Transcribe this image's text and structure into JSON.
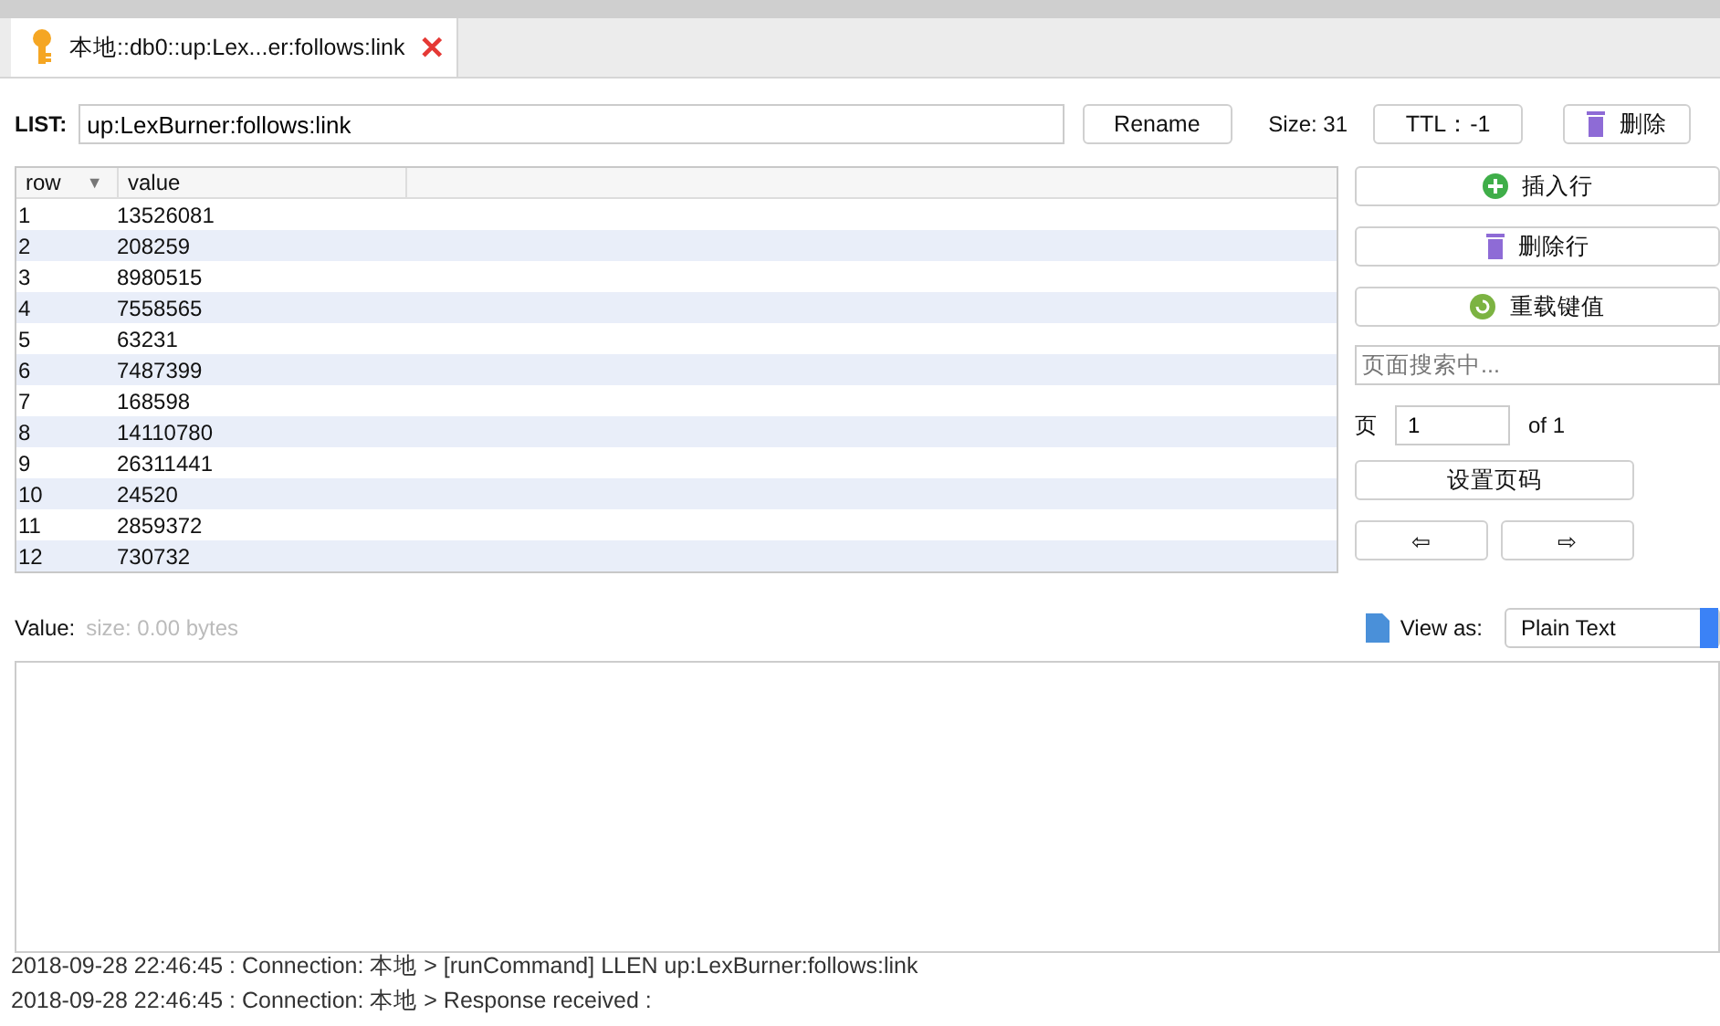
{
  "tab": {
    "title": "本地::db0::up:Lex...er:follows:link",
    "close": "✕"
  },
  "toolbar": {
    "type_label": "LIST:",
    "key_name": "up:LexBurner:follows:link",
    "rename": "Rename",
    "size": "Size: 31",
    "ttl": "TTL：-1",
    "delete": "删除"
  },
  "table": {
    "columns": [
      "row",
      "value"
    ],
    "sort_mark": "▼",
    "rows": [
      [
        "1",
        "13526081"
      ],
      [
        "2",
        "208259"
      ],
      [
        "3",
        "8980515"
      ],
      [
        "4",
        "7558565"
      ],
      [
        "5",
        "63231"
      ],
      [
        "6",
        "7487399"
      ],
      [
        "7",
        "168598"
      ],
      [
        "8",
        "14110780"
      ],
      [
        "9",
        "26311441"
      ],
      [
        "10",
        "24520"
      ],
      [
        "11",
        "2859372"
      ],
      [
        "12",
        "730732"
      ]
    ]
  },
  "side": {
    "insert_row": "插入行",
    "delete_row": "删除行",
    "reload": "重载键值",
    "search_placeholder": "页面搜索中...",
    "page_label": "页",
    "page_value": "1",
    "page_of": "of 1",
    "set_page": "设置页码",
    "prev": "⇦",
    "next": "⇨"
  },
  "value": {
    "label": "Value:",
    "size": "size: 0.00 bytes",
    "view_as_label": "View as:",
    "view_as": "Plain Text"
  },
  "log": [
    "2018-09-28 22:46:45 : Connection: 本地 > [runCommand] LLEN up:LexBurner:follows:link",
    "2018-09-28 22:46:45 : Connection: 本地 > Response received :"
  ]
}
